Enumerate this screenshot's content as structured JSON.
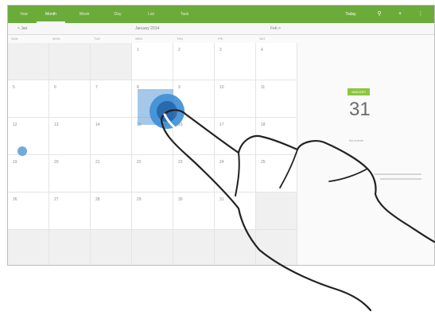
{
  "topbar": {
    "tabs": [
      {
        "label": "Year"
      },
      {
        "label": "Month"
      },
      {
        "label": "Week"
      },
      {
        "label": "Day"
      },
      {
        "label": "List"
      },
      {
        "label": "Task"
      }
    ],
    "active_tab": "Month",
    "today_label": "Today",
    "accent_color": "#6aab3a"
  },
  "subbar": {
    "prev_label": "< Jan",
    "month_title": "January 2014",
    "next_label": "Feb >"
  },
  "weekdays": [
    "SUN",
    "MON",
    "TUE",
    "WED",
    "THU",
    "FRI",
    "SAT"
  ],
  "calendar": {
    "rows": [
      [
        "",
        "",
        "",
        "1",
        "2",
        "3",
        "4"
      ],
      [
        "5",
        "6",
        "7",
        "8",
        "9",
        "10",
        "11"
      ],
      [
        "12",
        "13",
        "14",
        "15",
        "16",
        "17",
        "18"
      ],
      [
        "19",
        "20",
        "21",
        "22",
        "23",
        "24",
        "25"
      ],
      [
        "26",
        "27",
        "28",
        "29",
        "30",
        "31",
        ""
      ],
      [
        "",
        "",
        "",
        "",
        "",
        "",
        ""
      ]
    ],
    "selected_color": "#5b9bd5"
  },
  "side_panel": {
    "badge": "JANUARY",
    "date": "31",
    "note": "No events"
  },
  "icons": [
    "search-icon",
    "add-icon",
    "more-icon"
  ]
}
